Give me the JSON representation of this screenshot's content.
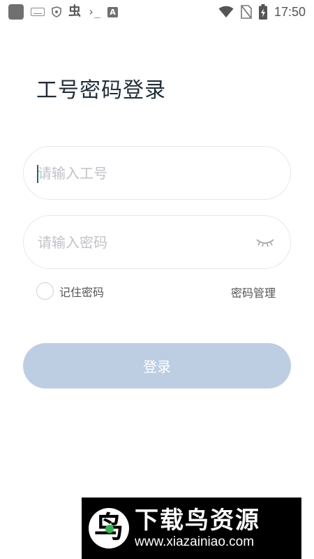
{
  "status_bar": {
    "time": "17:50",
    "left_icons": [
      "app-square-icon",
      "keyboard-icon",
      "shield-icon",
      "bug-icon",
      "terminal-icon",
      "font-a-icon"
    ],
    "right_icons": [
      "wifi-icon",
      "no-sim-icon",
      "battery-charging-icon"
    ],
    "bug_glyph": "虫",
    "terminal_glyph": "›_",
    "a_glyph": "A"
  },
  "page": {
    "title": "工号密码登录"
  },
  "form": {
    "employee_id": {
      "placeholder": "请输入工号",
      "value": ""
    },
    "password": {
      "placeholder": "请输入密码",
      "value": "",
      "visibility_icon": "eye-closed-icon"
    },
    "remember_label": "记住密码",
    "remember_checked": false,
    "manage_link": "密码管理",
    "login_button": "登录"
  },
  "watermark": {
    "logo_glyph": "鸟",
    "title": "下载鸟资源",
    "url": "www.xiazainiao.com"
  },
  "colors": {
    "title": "#1f2d3a",
    "placeholder": "#c2c2c8",
    "button_bg": "#bdcee3",
    "field_border": "#e6e6ea",
    "caret": "#1b6b6b"
  }
}
